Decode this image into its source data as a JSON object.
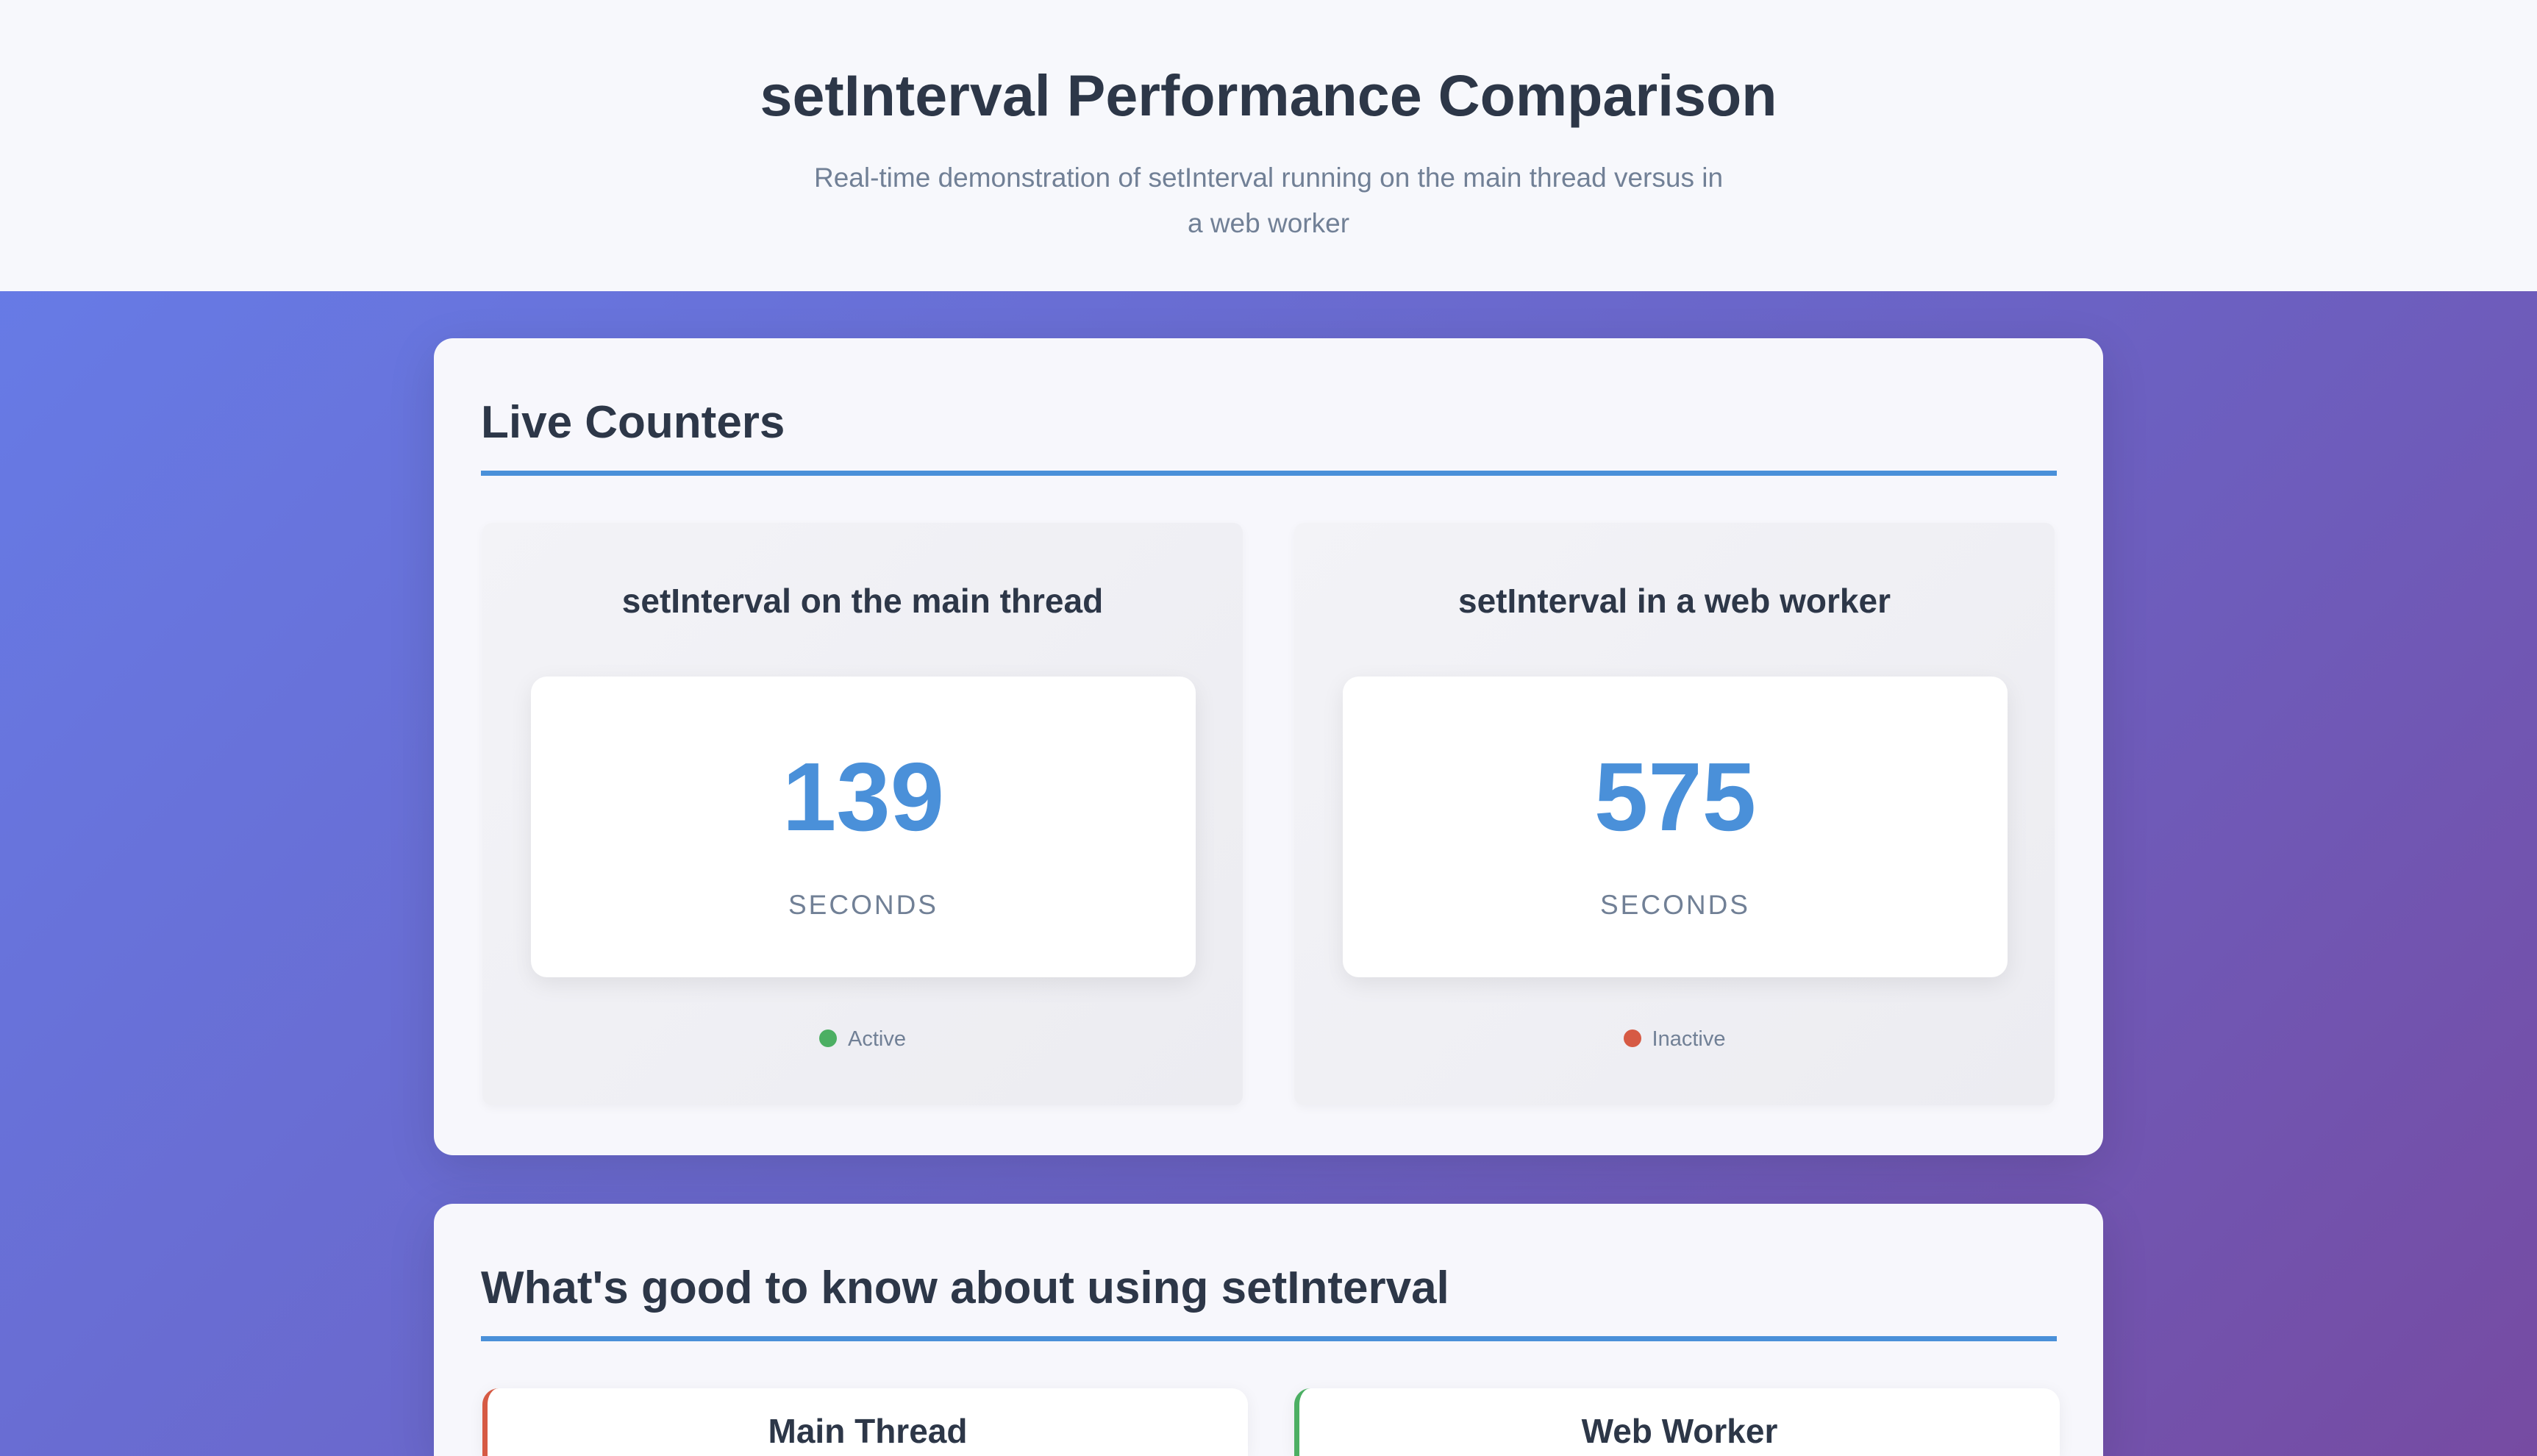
{
  "header": {
    "title": "setInterval Performance Comparison",
    "subtitle": "Real-time demonstration of setInterval running on the main thread versus in a web worker"
  },
  "live": {
    "title": "Live Counters",
    "panels": [
      {
        "title": "setInterval on the main thread",
        "value": "139",
        "unit": "SECONDS",
        "status": "Active",
        "status_color": "#4caf63"
      },
      {
        "title": "setInterval in a web worker",
        "value": "575",
        "unit": "SECONDS",
        "status": "Inactive",
        "status_color": "#d65a44"
      }
    ]
  },
  "info": {
    "title": "What's good to know about using setInterval",
    "cards": [
      {
        "title": "Main Thread",
        "accent": "#d65a44"
      },
      {
        "title": "Web Worker",
        "accent": "#4caf63"
      }
    ]
  }
}
